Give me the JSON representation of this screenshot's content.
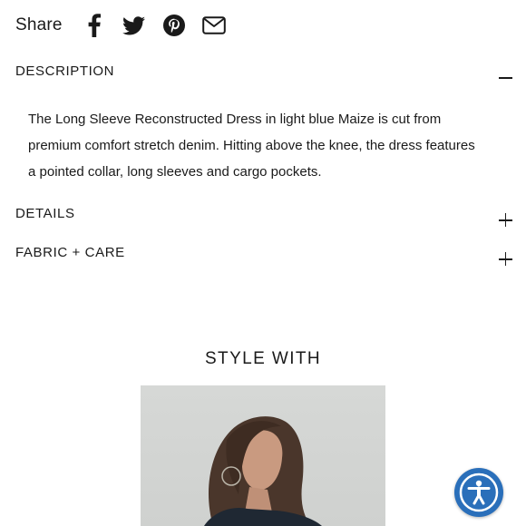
{
  "share": {
    "label": "Share",
    "icons": [
      "facebook-icon",
      "twitter-icon",
      "pinterest-icon",
      "email-icon"
    ]
  },
  "accordion": {
    "description": {
      "title": "DESCRIPTION",
      "expanded": true,
      "text": "The Long Sleeve Reconstructed Dress in light blue Maize is cut from premium comfort stretch denim. Hitting above the knee, the dress features a pointed collar, long sleeves and cargo pockets."
    },
    "details": {
      "title": "DETAILS",
      "expanded": false
    },
    "fabric_care": {
      "title": "FABRIC + CARE",
      "expanded": false
    }
  },
  "style_with": {
    "heading": "STYLE WITH"
  },
  "accessibility": {
    "icon": "accessibility-icon",
    "color": "#2a6fba"
  }
}
